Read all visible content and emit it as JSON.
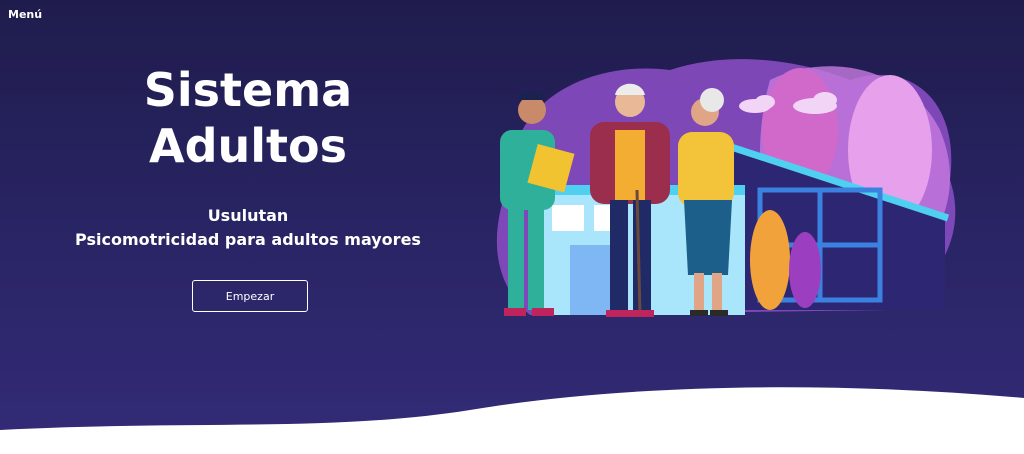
{
  "nav": {
    "menu_label": "Menú"
  },
  "hero": {
    "title_line1": "Sistema",
    "title_line2": "Adultos",
    "location": "Usulutan",
    "tagline": "Psicomotricidad para adultos mayores",
    "cta_label": "Empezar"
  },
  "colors": {
    "background": "#28245f",
    "button_border": "#ffffff",
    "illustration_purple": "#9b5fd0",
    "illustration_blue": "#4fd0f0"
  },
  "illustration": {
    "icons": [
      "caregiver-figure",
      "elderly-man-figure",
      "elderly-woman-figure",
      "house-icon",
      "cloud-icon",
      "tree-icon"
    ]
  }
}
